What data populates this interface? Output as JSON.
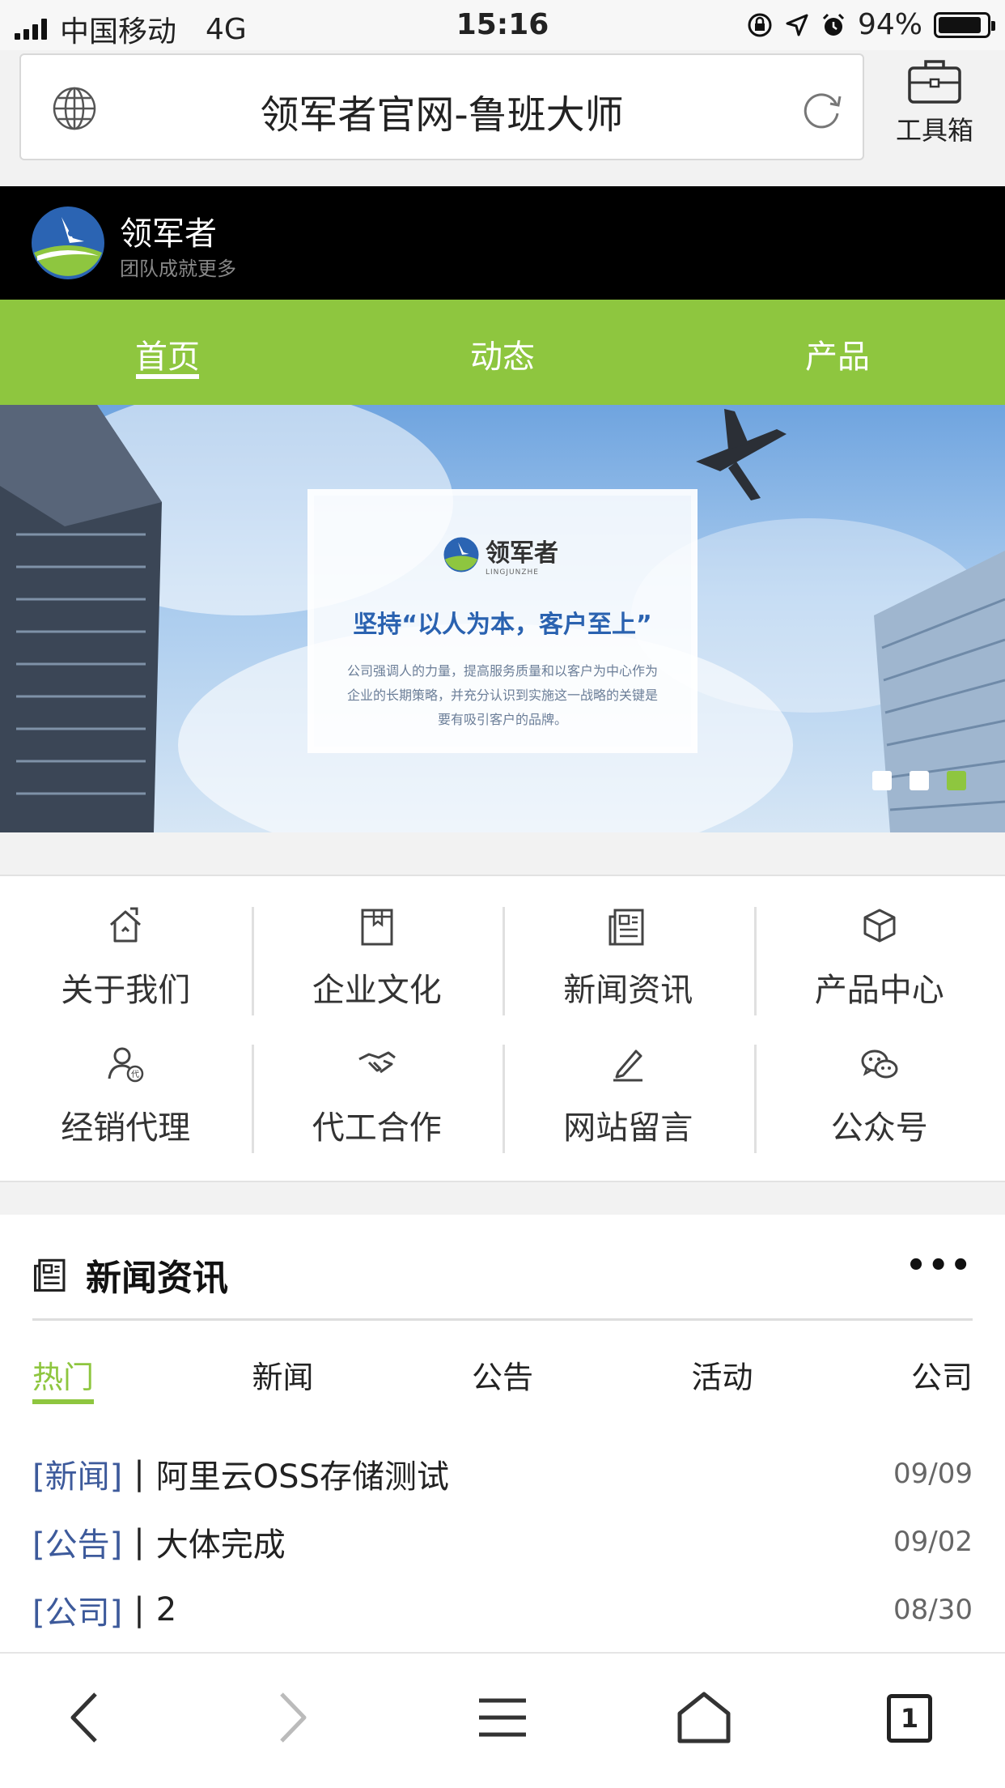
{
  "status_bar": {
    "carrier": "中国移动",
    "network": "4G",
    "time": "15:16",
    "battery": "94%"
  },
  "url_bar": {
    "title": "领军者官网-鲁班大师",
    "toolbox_label": "工具箱"
  },
  "brand": {
    "name": "领军者",
    "slogan": "团队成就更多"
  },
  "nav": {
    "items": [
      {
        "label": "首页",
        "active": true
      },
      {
        "label": "动态"
      },
      {
        "label": "产品"
      }
    ]
  },
  "banner": {
    "brand": "领军者",
    "brand_en": "LINGJUNZHE",
    "motto": "坚持“以人为本，客户至上”",
    "description": "公司强调人的力量，提高服务质量和以客户为中心作为企业的长期策略，并充分认识到实施这一战略的关键是要有吸引客户的品牌。",
    "slide_count": 3,
    "active_slide": 3
  },
  "grid": {
    "items": [
      {
        "label": "关于我们",
        "icon": "house-icon"
      },
      {
        "label": "企业文化",
        "icon": "book-icon"
      },
      {
        "label": "新闻资讯",
        "icon": "newspaper-icon"
      },
      {
        "label": "产品中心",
        "icon": "box-icon"
      },
      {
        "label": "经销代理",
        "icon": "agent-icon"
      },
      {
        "label": "代工合作",
        "icon": "handshake-icon"
      },
      {
        "label": "网站留言",
        "icon": "pencil-icon"
      },
      {
        "label": "公众号",
        "icon": "wechat-icon"
      }
    ]
  },
  "news": {
    "title": "新闻资讯",
    "more": "•••",
    "tabs": [
      "热门",
      "新闻",
      "公告",
      "活动",
      "公司"
    ],
    "active_tab": "热门",
    "items": [
      {
        "category": "[新闻]",
        "separator": "|",
        "title": "阿里云OSS存储测试",
        "date": "09/09"
      },
      {
        "category": "[公告]",
        "separator": "|",
        "title": "大体完成",
        "date": "09/02"
      },
      {
        "category": "[公司]",
        "separator": "|",
        "title": "2",
        "date": "08/30"
      }
    ]
  },
  "bottom_bar": {
    "tab_count": "1"
  },
  "colors": {
    "accent_green": "#8ec63f",
    "brand_black": "#000000",
    "news_category": "#3d5a9b"
  }
}
